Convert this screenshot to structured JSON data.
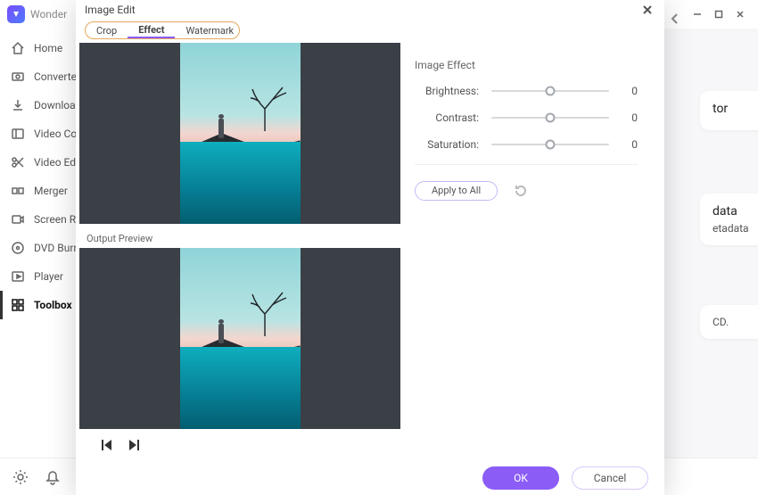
{
  "app": {
    "title_fragment": "Wonder"
  },
  "sidebar": {
    "items": [
      {
        "label": "Home"
      },
      {
        "label": "Converter"
      },
      {
        "label": "Download"
      },
      {
        "label": "Video Compressor"
      },
      {
        "label": "Video Editor"
      },
      {
        "label": "Merger"
      },
      {
        "label": "Screen Recorder"
      },
      {
        "label": "DVD Burner"
      },
      {
        "label": "Player"
      },
      {
        "label": "Toolbox"
      }
    ]
  },
  "cards": {
    "c1": {
      "title_fragment": "tor"
    },
    "c2": {
      "title_fragment": "data",
      "sub_fragment": "etadata"
    },
    "c3": {
      "text_fragment": "CD."
    }
  },
  "modal": {
    "title": "Image Edit",
    "tabs": [
      {
        "label": "Crop"
      },
      {
        "label": "Effect"
      },
      {
        "label": "Watermark"
      }
    ],
    "output_label": "Output Preview",
    "effects": {
      "section": "Image Effect",
      "rows": [
        {
          "label": "Brightness:",
          "value": "0"
        },
        {
          "label": "Contrast:",
          "value": "0"
        },
        {
          "label": "Saturation:",
          "value": "0"
        }
      ],
      "apply_all": "Apply to All"
    },
    "buttons": {
      "ok": "OK",
      "cancel": "Cancel"
    }
  }
}
